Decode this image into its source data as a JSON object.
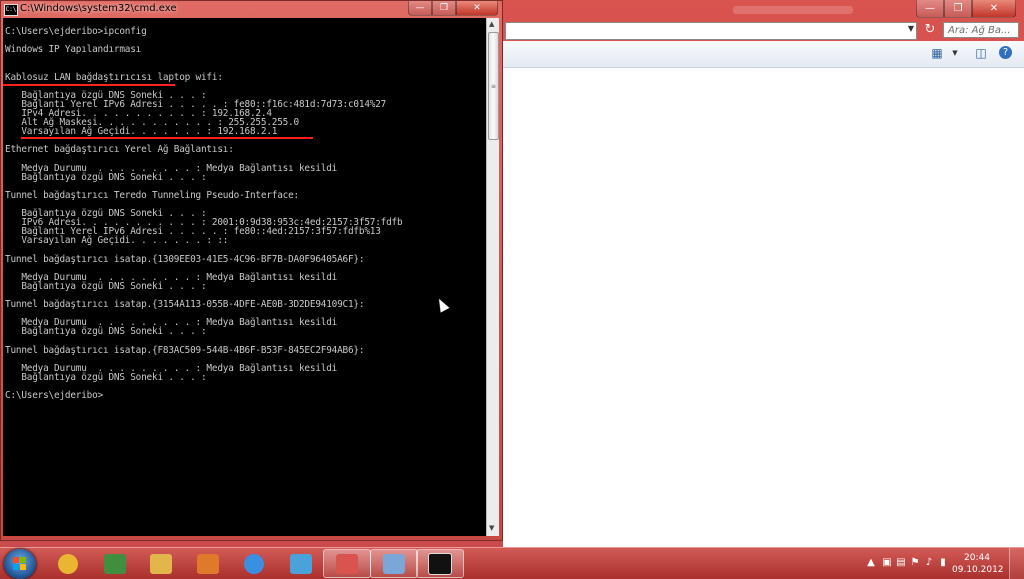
{
  "cmd": {
    "title": "C:\\Windows\\system32\\cmd.exe",
    "lines": [
      "C:\\Users\\ejderibo>ipconfig",
      "",
      "Windows IP Yapılandırması",
      "",
      "",
      "Kablosuz LAN bağdaştırıcısı laptop wifi:",
      "",
      "   Bağlantıya özgü DNS Soneki . . . :",
      "   Bağlantı Yerel IPv6 Adresi . . . . . : fe80::f16c:481d:7d73:c014%27",
      "   IPv4 Adresi. . . . . . . . . . . : 192.168.2.4",
      "   Alt Ağ Maskesi. . . . . . . . . . . : 255.255.255.0",
      "   Varsayılan Ağ Geçidi. . . . . . . : 192.168.2.1",
      "",
      "Ethernet bağdaştırıcı Yerel Ağ Bağlantısı:",
      "",
      "   Medya Durumu  . . . . . . . . . : Medya Bağlantısı kesildi",
      "   Bağlantıya özgü DNS Soneki . . . :",
      "",
      "Tunnel bağdaştırıcı Teredo Tunneling Pseudo-Interface:",
      "",
      "   Bağlantıya özgü DNS Soneki . . . :",
      "   IPv6 Adresi. . . . . . . . . . . : 2001:0:9d38:953c:4ed:2157:3f57:fdfb",
      "   Bağlantı Yerel IPv6 Adresi . . . . . : fe80::4ed:2157:3f57:fdfb%13",
      "   Varsayılan Ağ Geçidi. . . . . . . : ::",
      "",
      "Tunnel bağdaştırıcı isatap.{1309EE03-41E5-4C96-BF7B-DA0F96405A6F}:",
      "",
      "   Medya Durumu  . . . . . . . . . : Medya Bağlantısı kesildi",
      "   Bağlantıya özgü DNS Soneki . . . :",
      "",
      "Tunnel bağdaştırıcı isatap.{3154A113-055B-4DFE-AE0B-3D2DE94109C1}:",
      "",
      "   Medya Durumu  . . . . . . . . . : Medya Bağlantısı kesildi",
      "   Bağlantıya özgü DNS Soneki . . . :",
      "",
      "Tunnel bağdaştırıcı isatap.{F83AC509-544B-4B6F-B53F-845EC2F94AB6}:",
      "",
      "   Medya Durumu  . . . . . . . . . : Medya Bağlantısı kesildi",
      "   Bağlantıya özgü DNS Soneki . . . :",
      "",
      "C:\\Users\\ejderibo>"
    ],
    "highlight_color": "#ff2020"
  },
  "explorer": {
    "search_placeholder": "Ara: Ağ Ba..."
  },
  "taskbar": {
    "apps": [
      {
        "name": "chrome-icon",
        "color": "#e8b630"
      },
      {
        "name": "calculator-icon",
        "color": "#3f8f3f"
      },
      {
        "name": "folder-icon",
        "color": "#e2b64a"
      },
      {
        "name": "media-player-icon",
        "color": "#e07a2a"
      },
      {
        "name": "internet-explorer-icon",
        "color": "#3b8fe0"
      },
      {
        "name": "network-icon",
        "color": "#4aa3d8"
      },
      {
        "name": "windows-flag-icon",
        "color": "#d9534f"
      },
      {
        "name": "control-panel-icon",
        "color": "#7aa6d8"
      },
      {
        "name": "cmd-icon",
        "color": "#111111"
      }
    ],
    "clock_time": "20:44",
    "clock_date": "09.10.2012"
  }
}
